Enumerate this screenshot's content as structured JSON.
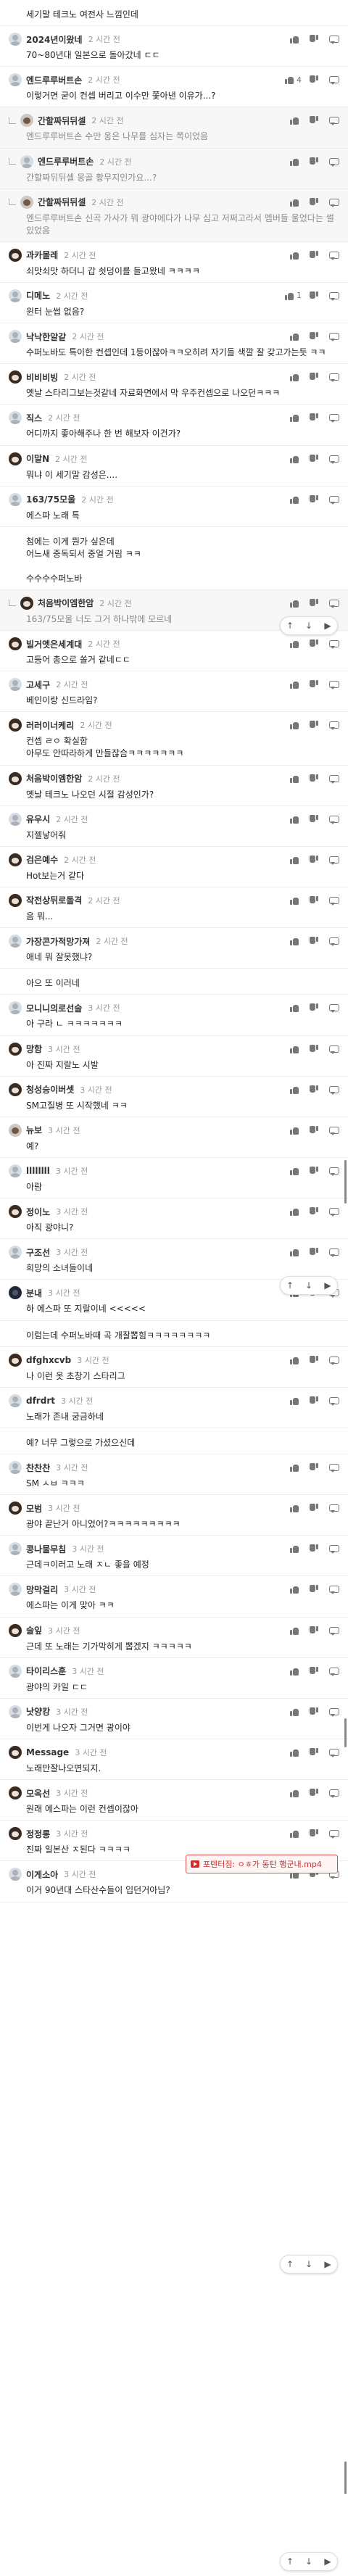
{
  "comments": [
    {
      "nick": "",
      "time": "",
      "body": "세기말 테크노 여전사 느낌인데",
      "likes": "",
      "dislikes": "",
      "avatar": "none",
      "reply": false,
      "partial": true
    },
    {
      "nick": "2024년이왔네",
      "time": "2 시간 전",
      "body": "70~80년대 일본으로 돌아갔네 ㄷㄷ",
      "likes": "",
      "dislikes": "",
      "avatar": "default",
      "reply": false
    },
    {
      "nick": "엔드루루버트손",
      "time": "2 시간 전",
      "body": "이렇거면 굳이 컨셉 버리고 이수만 쫓아낸 이유가...?",
      "likes": "4",
      "dislikes": "",
      "avatar": "default",
      "reply": false
    },
    {
      "nick": "간할짜뒤뒤셀",
      "time": "2 시간 전",
      "body": "수만 옹은 나무를 심자는 쪽이었음",
      "likes": "",
      "dislikes": "",
      "avatar": "cat",
      "reply": true,
      "mention": "엔드루루버트손"
    },
    {
      "nick": "엔드루루버트손",
      "time": "2 시간 전",
      "body": "몽골 황무지인가요...?",
      "likes": "",
      "dislikes": "",
      "avatar": "default",
      "reply": true,
      "mention": "간할짜뒤뒤셀"
    },
    {
      "nick": "간할짜뒤뒤셀",
      "time": "2 시간 전",
      "body": "신곡 가사가 뭐 광야에다가 나무 심고 저쩌고라서 멤버들 울었다는 썰 있었음",
      "likes": "",
      "dislikes": "",
      "avatar": "cat",
      "reply": true,
      "mention": "엔드루루버트손"
    },
    {
      "nick": "과카몰레",
      "time": "2 시간 전",
      "body": "쇠맛쇠맛 하더니 갑 쇳덩이를 들고왔네 ㅋㅋㅋㅋ",
      "likes": "",
      "dislikes": "",
      "avatar": "bear",
      "reply": false
    },
    {
      "nick": "디메노",
      "time": "2 시간 전",
      "body": "윈터 눈썹 없음?",
      "likes": "1",
      "dislikes": "",
      "avatar": "default",
      "reply": false
    },
    {
      "nick": "낙낙한알같",
      "time": "2 시간 전",
      "body": "수퍼노바도 특이한 컨셉인데 1등이잖아ㅋㅋ오히려 자기들 색깔 잘 갖고가는듯 ㅋㅋ",
      "likes": "",
      "dislikes": "",
      "avatar": "default",
      "reply": false
    },
    {
      "nick": "비비비빙",
      "time": "2 시간 전",
      "body": "옛날 스타리그보는것같네 자료화면에서 막 우주컨셉으로 나오던ㅋㅋㅋ",
      "likes": "",
      "dislikes": "",
      "avatar": "bear",
      "reply": false
    },
    {
      "nick": "직스",
      "time": "2 시간 전",
      "body": "어디까지 좋아해주나 한 번 해보자 이건가?",
      "likes": "",
      "dislikes": "",
      "avatar": "default",
      "reply": false
    },
    {
      "nick": "이말N",
      "time": "2 시간 전",
      "body": "뭐냐 이 세기말 감성은....",
      "likes": "",
      "dislikes": "",
      "avatar": "bear",
      "reply": false
    },
    {
      "nick": "163/75모울",
      "time": "2 시간 전",
      "body": "에스파 노래 특",
      "likes": "",
      "dislikes": "",
      "avatar": "default",
      "reply": false
    },
    {
      "nick": "",
      "time": "",
      "body": "첨에는 이게 뭔가 싶은데\n어느새 중독되서 중얼 거림 ㅋㅋ\n\n수수수수퍼노바",
      "likes": "",
      "dislikes": "",
      "avatar": "none",
      "reply": false,
      "partial": true
    },
    {
      "nick": "처음박이엠한암",
      "time": "2 시간 전",
      "body": "너도 그거 하나밖에 모르네",
      "likes": "",
      "dislikes": "",
      "avatar": "bear",
      "reply": true,
      "mention": "163/75모울"
    },
    {
      "nick": "빌거엣은세계대",
      "time": "2 시간 전",
      "body": "고등어 총으로 쏠거 같네ㄷㄷ",
      "likes": "",
      "dislikes": "",
      "avatar": "bear",
      "reply": false
    },
    {
      "nick": "고세구",
      "time": "2 시간 전",
      "body": "베인이랑 신드라임?",
      "likes": "",
      "dislikes": "",
      "avatar": "default",
      "reply": false
    },
    {
      "nick": "러러이너케리",
      "time": "2 시간 전",
      "body": "컨셉 ㄹㅇ 확실함\n아무도 안따라하게 만들잖슴ㅋㅋㅋㅋㅋㅋㅋ",
      "likes": "",
      "dislikes": "",
      "avatar": "bear",
      "reply": false
    },
    {
      "nick": "처음박이엠한암",
      "time": "2 시간 전",
      "body": "옛날 테크노 나오던 시절 감성인가?",
      "likes": "",
      "dislikes": "",
      "avatar": "bear",
      "reply": false
    },
    {
      "nick": "유우시",
      "time": "2 시간 전",
      "body": "지젤낳어줘",
      "likes": "",
      "dislikes": "",
      "avatar": "default",
      "reply": false
    },
    {
      "nick": "검은예수",
      "time": "2 시간 전",
      "body": "Hot보는거 같다",
      "likes": "",
      "dislikes": "",
      "avatar": "bear",
      "reply": false
    },
    {
      "nick": "작전상뒤로돌격",
      "time": "2 시간 전",
      "body": "음 뭐...",
      "likes": "",
      "dislikes": "",
      "avatar": "bear",
      "reply": false
    },
    {
      "nick": "가장콘가적망가져",
      "time": "2 시간 전",
      "body": "애네 뭐 잘못했냐?",
      "likes": "",
      "dislikes": "",
      "avatar": "default",
      "reply": false
    },
    {
      "nick": "",
      "time": "",
      "body": "아으 또 이러네",
      "likes": "",
      "dislikes": "",
      "avatar": "none",
      "reply": false,
      "partial": true
    },
    {
      "nick": "모니니의로선술",
      "time": "3 시간 전",
      "body": "아 구라 ㄴ ㅋㅋㅋㅋㅋㅋㅋ",
      "likes": "",
      "dislikes": "",
      "avatar": "default",
      "reply": false
    },
    {
      "nick": "망함",
      "time": "3 시간 전",
      "body": "아 진짜 지랄노 시발",
      "likes": "",
      "dislikes": "",
      "avatar": "bear",
      "reply": false
    },
    {
      "nick": "청성승이버셋",
      "time": "3 시간 전",
      "body": "SM고질병 또 시작했네 ㅋㅋ",
      "likes": "",
      "dislikes": "",
      "avatar": "bear",
      "reply": false
    },
    {
      "nick": "뉴보",
      "time": "3 시간 전",
      "body": "예?",
      "likes": "",
      "dislikes": "",
      "avatar": "cat",
      "reply": false
    },
    {
      "nick": "llllllll",
      "time": "3 시간 전",
      "body": "아람",
      "likes": "",
      "dislikes": "",
      "avatar": "default",
      "reply": false
    },
    {
      "nick": "정이노",
      "time": "3 시간 전",
      "body": "아직 광야니?",
      "likes": "",
      "dislikes": "",
      "avatar": "bear",
      "reply": false
    },
    {
      "nick": "구조선",
      "time": "3 시간 전",
      "body": "희망의 소녀들이네",
      "likes": "",
      "dislikes": "",
      "avatar": "default",
      "reply": false
    },
    {
      "nick": "분내",
      "time": "3 시간 전",
      "body": "하 에스파 또 지랄이네 <<<<<",
      "likes": "",
      "dislikes": "",
      "avatar": "dark",
      "reply": false
    },
    {
      "nick": "",
      "time": "",
      "body": "이럼는데 수퍼노바때 곡 개잘뽑힘ㅋㅋㅋㅋㅋㅋㅋㅋ",
      "likes": "",
      "dislikes": "",
      "avatar": "none",
      "reply": false,
      "partial": true
    },
    {
      "nick": "dfghxcvb",
      "time": "3 시간 전",
      "body": "나 이런 옷 초창기 스타리그",
      "likes": "",
      "dislikes": "",
      "avatar": "bear",
      "reply": false
    },
    {
      "nick": "dfrdrt",
      "time": "3 시간 전",
      "body": "노래가 존내 궁금하네",
      "likes": "",
      "dislikes": "",
      "avatar": "default",
      "reply": false
    },
    {
      "nick": "",
      "time": "",
      "body": "예? 너무 그렇으로 가셨으신데",
      "likes": "",
      "dislikes": "",
      "avatar": "none",
      "reply": false,
      "partial": true
    },
    {
      "nick": "찬찬찬",
      "time": "3 시간 전",
      "body": "SM ㅅㅂ ㅋㅋㅋ",
      "likes": "",
      "dislikes": "",
      "avatar": "default",
      "reply": false
    },
    {
      "nick": "모범",
      "time": "3 시간 전",
      "body": "광야 끝난거 아니었어?ㅋㅋㅋㅋㅋㅋㅋㅋㅋ",
      "likes": "",
      "dislikes": "",
      "avatar": "bear",
      "reply": false
    },
    {
      "nick": "콩나물무침",
      "time": "3 시간 전",
      "body": "근데ㅋ이러고 노래 ㅈㄴ 좋을 예정",
      "likes": "",
      "dislikes": "",
      "avatar": "default",
      "reply": false
    },
    {
      "nick": "망막걸리",
      "time": "3 시간 전",
      "body": "에스파는 이게 맞아 ㅋㅋ",
      "likes": "",
      "dislikes": "",
      "avatar": "default",
      "reply": false
    },
    {
      "nick": "술잎",
      "time": "3 시간 전",
      "body": "근데 또 노래는 기가막히게 뽑겠지 ㅋㅋㅋㅋㅋ",
      "likes": "",
      "dislikes": "",
      "avatar": "bear",
      "reply": false
    },
    {
      "nick": "타이리스훈",
      "time": "3 시간 전",
      "body": "광야의 카일 ㄷㄷ",
      "likes": "",
      "dislikes": "",
      "avatar": "default",
      "reply": false
    },
    {
      "nick": "낫양캉",
      "time": "3 시간 전",
      "body": "이번게 나오자 그거면 광이야",
      "likes": "",
      "dislikes": "",
      "avatar": "default",
      "reply": false
    },
    {
      "nick": "Message",
      "time": "3 시간 전",
      "body": "노래만잘나오면되지.",
      "likes": "",
      "dislikes": "",
      "avatar": "bear",
      "reply": false
    },
    {
      "nick": "모옥선",
      "time": "3 시간 전",
      "body": "원래 에스파는 이런 컨셉이잖아",
      "likes": "",
      "dislikes": "",
      "avatar": "bear",
      "reply": false
    },
    {
      "nick": "정정롱",
      "time": "3 시간 전",
      "body": "진짜 일본산 ㅈ된다 ㅋㅋㅋㅋ",
      "likes": "",
      "dislikes": "",
      "avatar": "bear",
      "reply": false
    },
    {
      "nick": "이게소아",
      "time": "3 시간 전",
      "body": "이거 90년대 스타산수들이 입던거아님?",
      "likes": "",
      "dislikes": "",
      "avatar": "default",
      "reply": false
    }
  ],
  "video_tooltip": "포텐터짐: ㅇㅎ가 동탄 행군내.mp4",
  "scroll_widgets": [
    {
      "label_up": "↑",
      "label_down": "↓",
      "label_menu": "▶"
    },
    {
      "label_up": "↑",
      "label_down": "↓",
      "label_menu": "▶"
    },
    {
      "label_up": "↑",
      "label_down": "↓",
      "label_menu": "▶"
    },
    {
      "label_up": "↑",
      "label_down": "↓",
      "label_menu": "▶"
    }
  ]
}
